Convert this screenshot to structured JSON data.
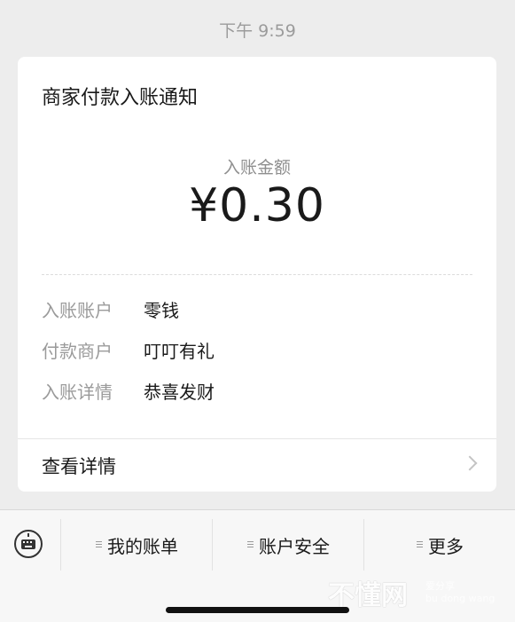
{
  "timestamp": "下午 9:59",
  "card": {
    "title": "商家付款入账通知",
    "amount_label": "入账金额",
    "amount_value": "¥0.30",
    "details": [
      {
        "key": "入账账户",
        "value": "零钱"
      },
      {
        "key": "付款商户",
        "value": "叮叮有礼"
      },
      {
        "key": "入账详情",
        "value": "恭喜发财"
      }
    ],
    "view_details_label": "查看详情"
  },
  "bottom_menu": {
    "items": [
      {
        "label": "我的账单"
      },
      {
        "label": "账户安全"
      },
      {
        "label": "更多"
      }
    ]
  },
  "watermark": {
    "main": "不懂网",
    "small": "爱分享",
    "pinyin": "bu dong wang"
  }
}
